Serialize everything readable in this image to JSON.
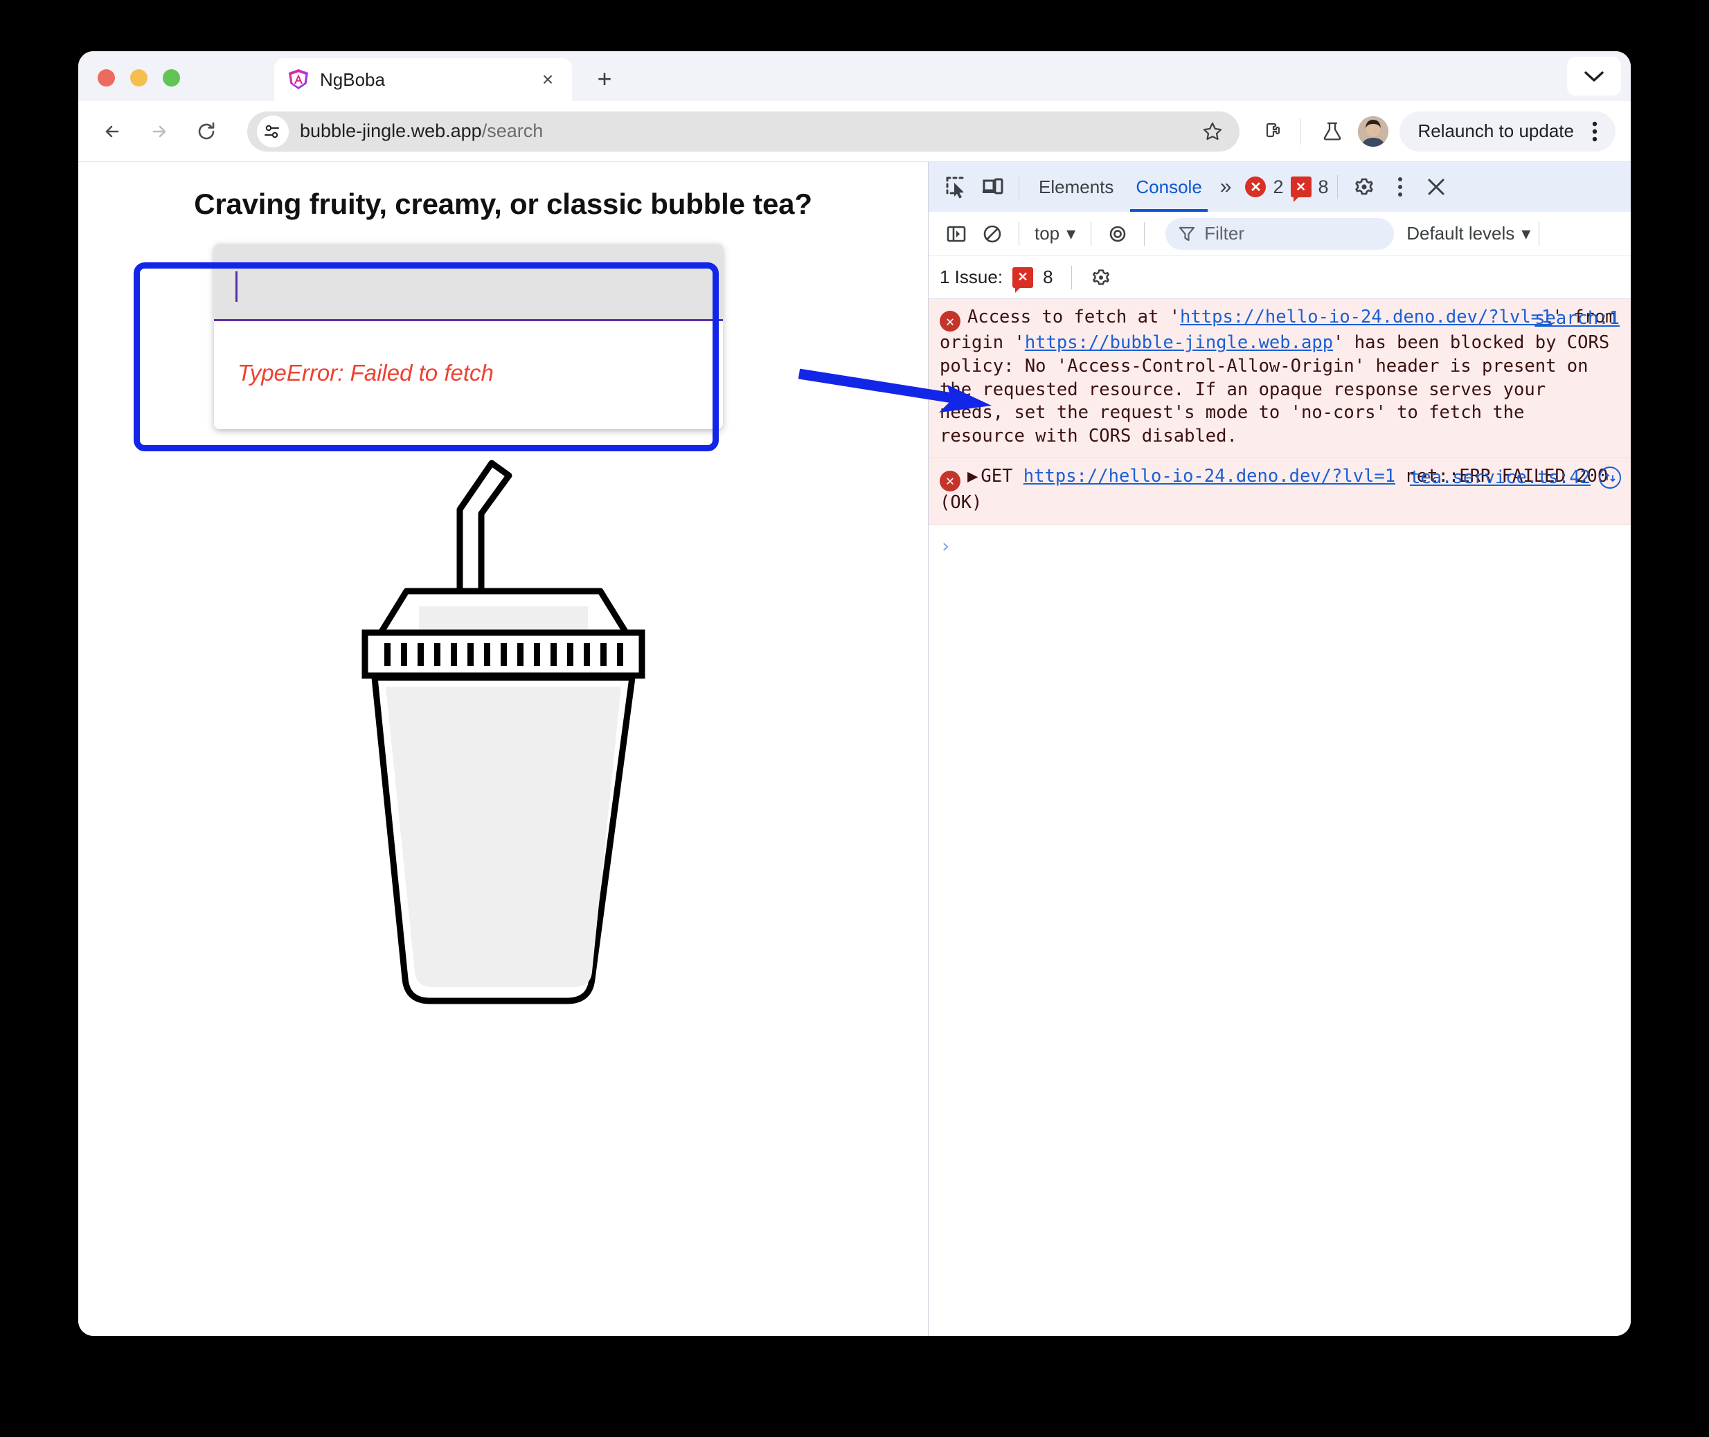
{
  "browser": {
    "traffic_lights": [
      "close",
      "minimize",
      "maximize"
    ],
    "tab": {
      "title": "NgBoba",
      "favicon": "angular-logo-icon",
      "close_label": "×"
    },
    "new_tab_label": "+",
    "tab_list_chevron": "chevron-down-icon",
    "toolbar": {
      "back": "back-arrow-icon",
      "forward": "forward-arrow-icon",
      "reload": "reload-icon",
      "site_info": "site-settings-icon",
      "url_host": "bubble-jingle.web.app",
      "url_path": "/search",
      "bookmark": "star-icon",
      "extensions": "extensions-puzzle-icon",
      "labs": "labs-flask-icon",
      "profile": "profile-avatar",
      "relaunch_label": "Relaunch to update",
      "menu": "kebab-menu-icon"
    }
  },
  "page": {
    "heading": "Craving fruity, creamy, or classic bubble tea?",
    "search_input_value": "",
    "search_input_placeholder": "",
    "error_message": "TypeError: Failed to fetch",
    "illustration": "boba-cup-illustration",
    "annotation": {
      "box": "highlight-rectangle",
      "arrow": "blue-arrow-pointer"
    }
  },
  "devtools": {
    "tabbar": {
      "inspect_icon": "inspect-element-icon",
      "device_toolbar_icon": "device-toolbar-icon",
      "tabs": [
        {
          "label": "Elements",
          "active": false
        },
        {
          "label": "Console",
          "active": true
        }
      ],
      "more_tabs": "»",
      "error_badge": {
        "icon": "error-circle-icon",
        "glyph": "✕",
        "count": "2"
      },
      "issue_badge": {
        "icon": "issue-square-icon",
        "glyph": "✕",
        "count": "8"
      },
      "settings_icon": "gear-icon",
      "menu_icon": "kebab-menu-icon",
      "close_icon": "close-icon"
    },
    "toolbar": {
      "sidebar_icon": "console-sidebar-icon",
      "clear_icon": "clear-console-icon",
      "context_label": "top",
      "context_chevron": "▾",
      "live_expression_icon": "eye-icon",
      "filter_icon": "filter-funnel-icon",
      "filter_placeholder": "Filter",
      "filter_value": "",
      "levels_label": "Default levels",
      "levels_chevron": "▾"
    },
    "issue_bar": {
      "text": "1 Issue:",
      "badge_glyph": "✕",
      "badge_count": "8",
      "settings_icon": "gear-icon"
    },
    "messages": [
      {
        "level": "error",
        "icon": "error-circle-icon",
        "glyph": "✕",
        "source": "search:1",
        "parts": [
          {
            "t": "text",
            "v": "Access to fetch at '"
          },
          {
            "t": "link",
            "v": "https://hello-io-24.deno.dev/?lvl=1"
          },
          {
            "t": "text",
            "v": "' from origin '"
          },
          {
            "t": "link",
            "v": "https://bubble-jingle.web.app"
          },
          {
            "t": "text",
            "v": "' has been blocked by CORS policy: No 'Access-Control-Allow-Origin' header is present on the requested resource. If an opaque response serves your needs, set the request's mode to 'no-cors' to fetch the resource with CORS disabled."
          }
        ]
      },
      {
        "level": "error",
        "icon": "error-circle-icon",
        "glyph": "✕",
        "source": "tea.service.ts:42",
        "has_jump_icon": true,
        "disclosure": "▶",
        "parts": [
          {
            "t": "text",
            "v": "GET "
          },
          {
            "t": "link",
            "v": "https://hello-io-24.deno.dev/?lvl=1"
          },
          {
            "t": "text",
            "v": " net::ERR_FAILED 200 (OK)"
          }
        ]
      }
    ],
    "prompt_glyph": "›"
  },
  "colors": {
    "accent_blue": "#0b57d0",
    "error_red": "#d93025",
    "annotation_blue": "#1226e8",
    "page_error_red": "#ef4130",
    "input_underline_purple": "#5b2ea6",
    "tab_strip_bg": "#f1f3f9",
    "devtools_tabbar_bg": "#e8edfa",
    "console_error_bg": "#fcecec"
  }
}
